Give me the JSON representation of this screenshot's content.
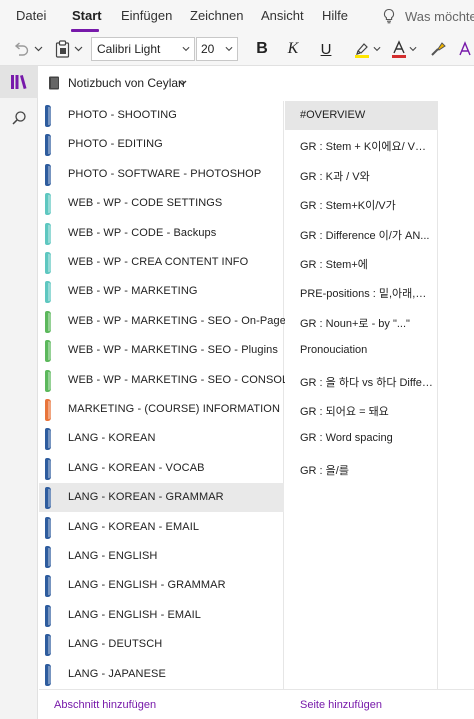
{
  "ribbon": {
    "tabs": [
      {
        "label": "Datei"
      },
      {
        "label": "Start"
      },
      {
        "label": "Einfügen"
      },
      {
        "label": "Zeichnen"
      },
      {
        "label": "Ansicht"
      },
      {
        "label": "Hilfe"
      }
    ],
    "active_tab": "Start",
    "tell_me_text": "Was möchten",
    "accent_color": "#7719aa"
  },
  "toolbar": {
    "font_name": "Calibri Light",
    "font_size": "20",
    "bold_label": "B",
    "italic_label": "K",
    "underline_label": "U",
    "font_color": "#d32f2f",
    "highlight_color": "#ffe600"
  },
  "rail": {
    "icons": [
      "notebooks-icon",
      "search-icon"
    ]
  },
  "notebook": {
    "title": "Notizbuch von Ceylan"
  },
  "sections": [
    {
      "label": "PHOTO - SHOOTING",
      "color": "#2e5c9e"
    },
    {
      "label": "PHOTO - EDITING",
      "color": "#2e5c9e"
    },
    {
      "label": "PHOTO - SOFTWARE - PHOTOSHOP",
      "color": "#2e5c9e"
    },
    {
      "label": "WEB - WP - CODE SETTINGS",
      "color": "#5ec7c0"
    },
    {
      "label": "WEB - WP - CODE - Backups",
      "color": "#5ec7c0"
    },
    {
      "label": "WEB - WP - CREA CONTENT INFO",
      "color": "#5ec7c0"
    },
    {
      "label": "WEB - WP - MARKETING",
      "color": "#5ec7c0"
    },
    {
      "label": "WEB - WP - MARKETING - SEO - On-Page",
      "color": "#5cb85c"
    },
    {
      "label": "WEB - WP - MARKETING - SEO - Plugins",
      "color": "#5cb85c"
    },
    {
      "label": "WEB - WP - MARKETING - SEO - CONSOLE",
      "color": "#5cb85c"
    },
    {
      "label": "MARKETING - (COURSE) INFORMATION",
      "color": "#e8743b"
    },
    {
      "label": "LANG - KOREAN",
      "color": "#2e5c9e"
    },
    {
      "label": "LANG - KOREAN - VOCAB",
      "color": "#2e5c9e"
    },
    {
      "label": "LANG - KOREAN - GRAMMAR",
      "color": "#2e5c9e",
      "selected": true
    },
    {
      "label": "LANG - KOREAN - EMAIL",
      "color": "#2e5c9e"
    },
    {
      "label": "LANG - ENGLISH",
      "color": "#2e5c9e"
    },
    {
      "label": "LANG - ENGLISH - GRAMMAR",
      "color": "#2e5c9e"
    },
    {
      "label": "LANG - ENGLISH - EMAIL",
      "color": "#2e5c9e"
    },
    {
      "label": "LANG - DEUTSCH",
      "color": "#2e5c9e"
    },
    {
      "label": "LANG - JAPANESE",
      "color": "#2e5c9e"
    }
  ],
  "pages": [
    {
      "label": "#OVERVIEW",
      "selected": true
    },
    {
      "label": "GR : Stem + K이에요/ V예..."
    },
    {
      "label": "GR : K과 / V와"
    },
    {
      "label": "GR : Stem+K이/V가"
    },
    {
      "label": "GR : Difference 이/가 AN..."
    },
    {
      "label": "GR : Stem+에"
    },
    {
      "label": "PRE-positions : 밑,아래,위,..."
    },
    {
      "label": "GR : Noun+로 - by \"...\""
    },
    {
      "label": "Pronouciation"
    },
    {
      "label": "GR : 을 하다 vs 하다 Differ..."
    },
    {
      "label": "GR : 되어요 = 돼요"
    },
    {
      "label": "GR : Word spacing"
    },
    {
      "label": "GR : 을/를"
    }
  ],
  "footer": {
    "add_section": "Abschnitt hinzufügen",
    "add_page": "Seite hinzufügen"
  }
}
